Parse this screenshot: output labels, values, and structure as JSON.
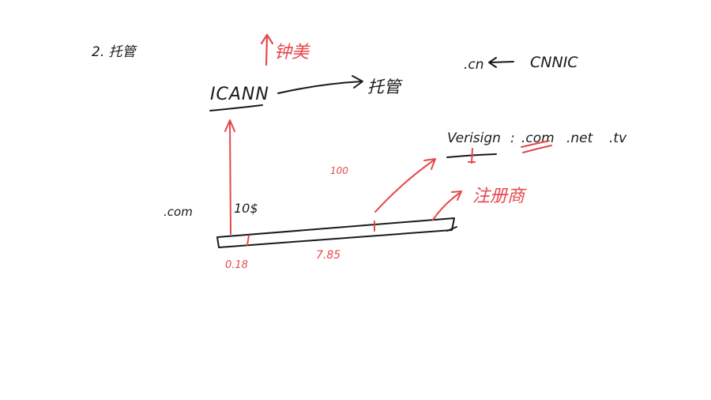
{
  "colors": {
    "ink": "#1a1a1a",
    "red": "#e5484d",
    "background": "#ffffff"
  },
  "notes": {
    "heading": "2. 托管",
    "icann": "ICANN",
    "hosting_target": "托管",
    "red_up_label": "钟美",
    "cn": ".cn",
    "cnnic": "CNNIC",
    "verisign": "Verisign",
    "colon": ":",
    "dot_com": ".com",
    "dot_net": ".net",
    "dot_tv": ".tv",
    "left_com": ".com",
    "price_10": "10$",
    "price_100": "100",
    "price_0_18": "0.18",
    "price_7_85": "7.85",
    "registrar": "注册商"
  }
}
